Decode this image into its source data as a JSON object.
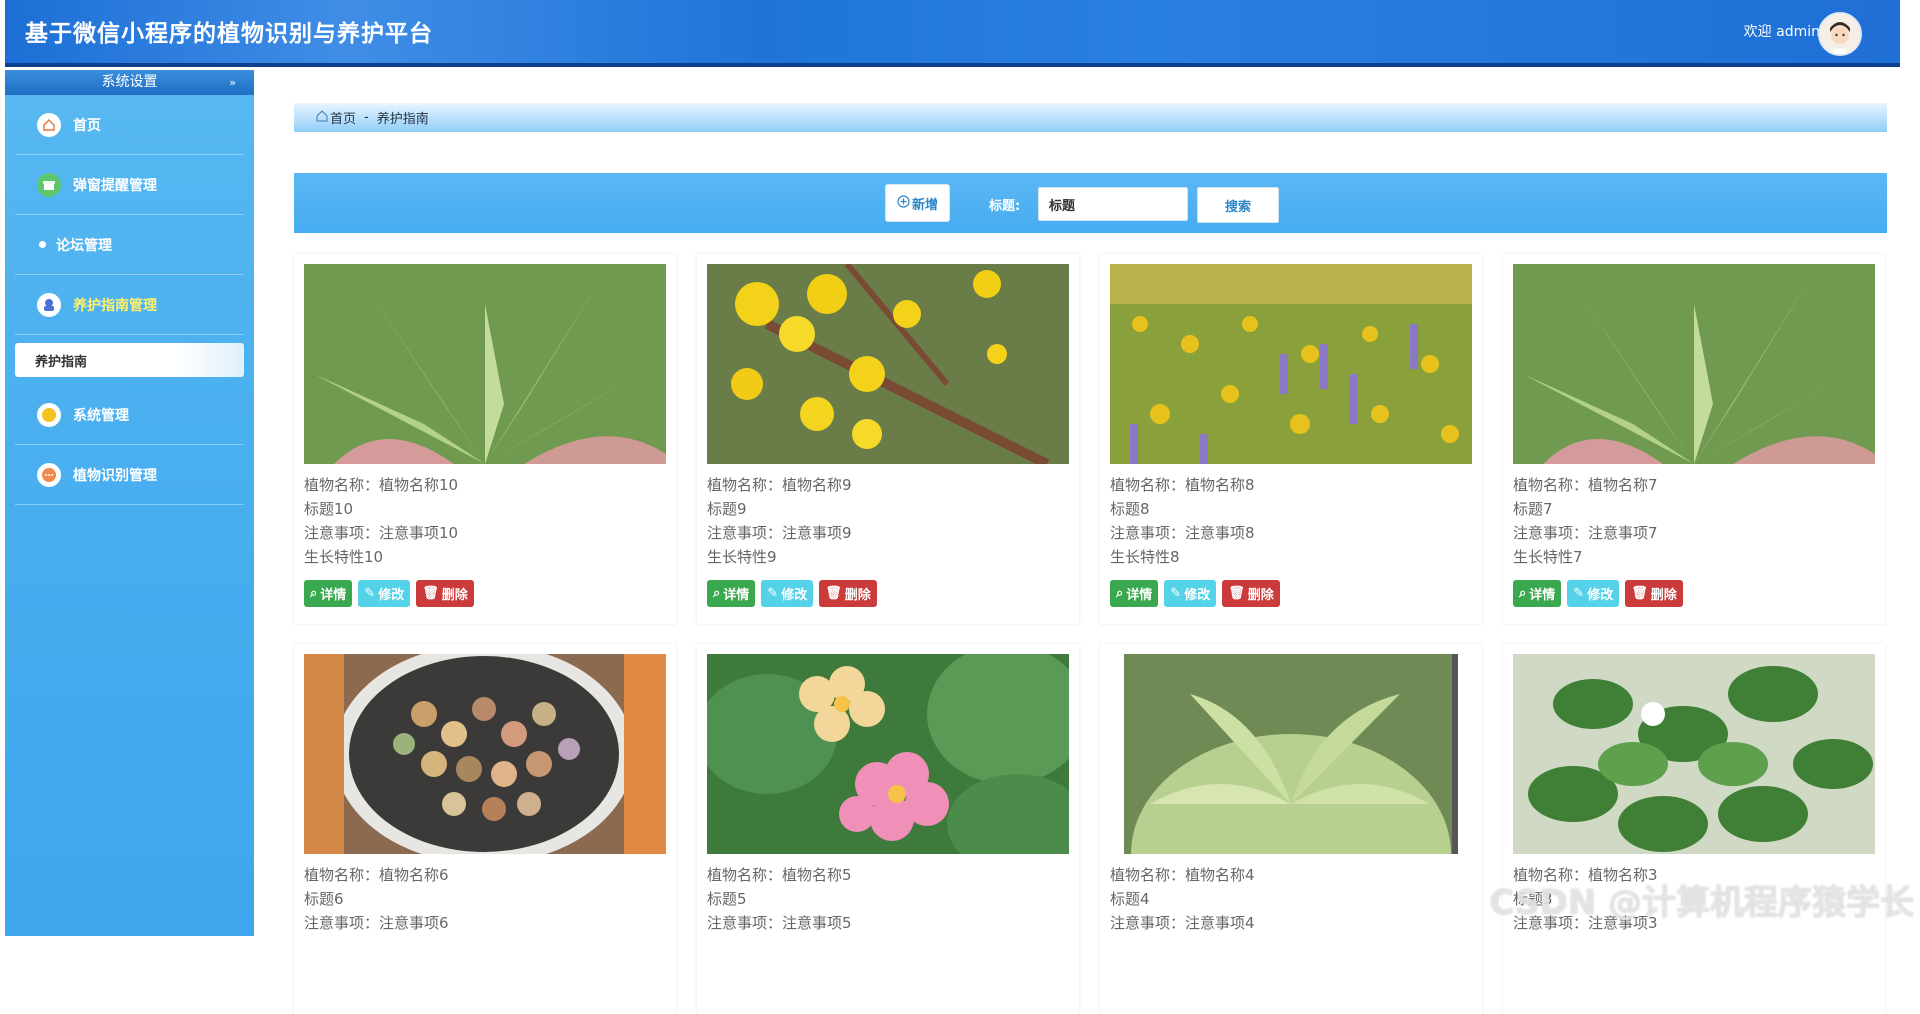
{
  "header": {
    "title": "基于微信小程序的植物识别与养护平台",
    "welcome": "欢迎 admin"
  },
  "sidebar": {
    "section_title": "系统设置",
    "items": [
      {
        "label": "首页",
        "icon": "home-icon"
      },
      {
        "label": "弹窗提醒管理",
        "icon": "gift-icon"
      },
      {
        "label": "论坛管理",
        "icon": "dot-icon"
      },
      {
        "label": "养护指南管理",
        "icon": "guide-icon"
      },
      {
        "label": "系统管理",
        "icon": "system-icon"
      },
      {
        "label": "植物识别管理",
        "icon": "identify-icon"
      }
    ],
    "active_sub": "养护指南"
  },
  "breadcrumb": {
    "home": "首页",
    "separator": "-",
    "current": "养护指南"
  },
  "toolbar": {
    "add_label": "新增",
    "search_label": "标题:",
    "search_value": "标题",
    "search_button": "搜索"
  },
  "cards": [
    {
      "name": "植物名称：植物名称10",
      "title": "标题10",
      "note": "注意事项：注意事项10",
      "growth": "生长特性10",
      "image": "succulent-green"
    },
    {
      "name": "植物名称：植物名称9",
      "title": "标题9",
      "note": "注意事项：注意事项9",
      "growth": "生长特性9",
      "image": "yellow-flower-branch"
    },
    {
      "name": "植物名称：植物名称8",
      "title": "标题8",
      "note": "注意事项：注意事项8",
      "growth": "生长特性8",
      "image": "wildflower-meadow"
    },
    {
      "name": "植物名称：植物名称7",
      "title": "标题7",
      "note": "注意事项：注意事项7",
      "growth": "生长特性7",
      "image": "succulent-green"
    },
    {
      "name": "植物名称：植物名称6",
      "title": "标题6",
      "note": "注意事项：注意事项6",
      "growth": "",
      "image": "lithops-pot"
    },
    {
      "name": "植物名称：植物名称5",
      "title": "标题5",
      "note": "注意事项：注意事项5",
      "growth": "",
      "image": "lantana-flowers"
    },
    {
      "name": "植物名称：植物名称4",
      "title": "标题4",
      "note": "注意事项：注意事项4",
      "growth": "",
      "image": "succulent-rosette"
    },
    {
      "name": "植物名称：植物名称3",
      "title": "标题3",
      "note": "注意事项：注意事项3",
      "growth": "",
      "image": "leafy-branch"
    }
  ],
  "actions": {
    "detail": "详情",
    "edit": "修改",
    "delete": "删除"
  },
  "watermark": "CSDN @计算机程序猿学长"
}
